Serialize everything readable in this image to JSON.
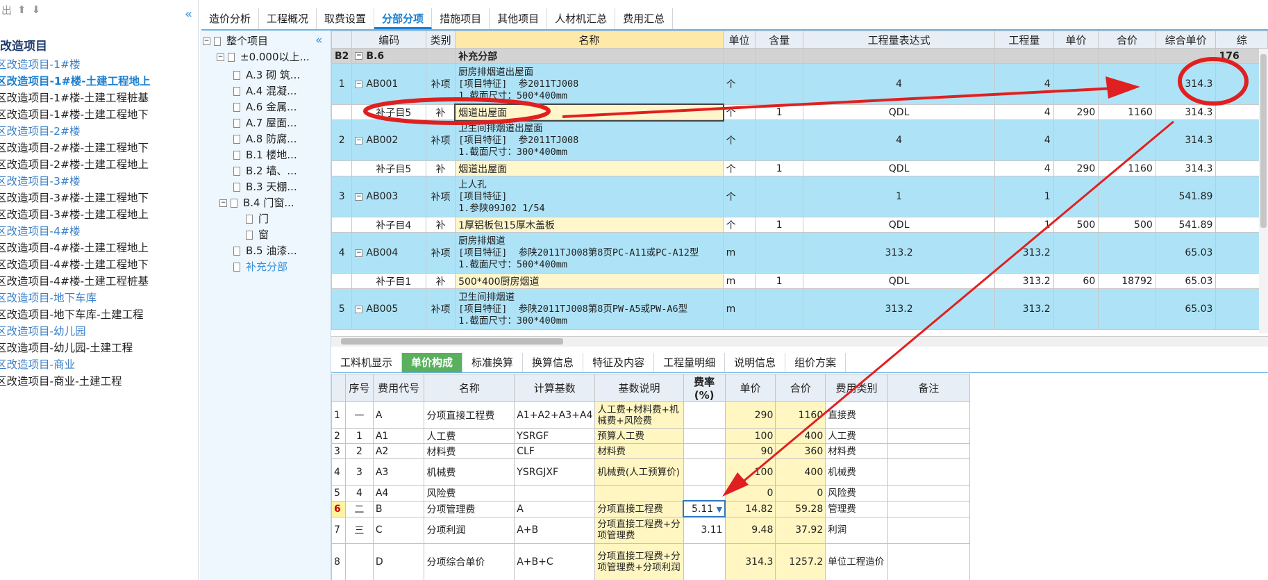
{
  "left_pane": {
    "toolbar_label": "出",
    "title": "改造项目",
    "items": [
      {
        "label": "区改造项目-1#楼",
        "type": "group"
      },
      {
        "label": "区改造项目-1#楼-土建工程地上",
        "type": "active"
      },
      {
        "label": "区改造项目-1#楼-土建工程桩基",
        "type": "item"
      },
      {
        "label": "区改造项目-1#楼-土建工程地下",
        "type": "item"
      },
      {
        "label": "区改造项目-2#楼",
        "type": "group"
      },
      {
        "label": "区改造项目-2#楼-土建工程地下",
        "type": "item"
      },
      {
        "label": "区改造项目-2#楼-土建工程地上",
        "type": "item"
      },
      {
        "label": "区改造项目-3#楼",
        "type": "group"
      },
      {
        "label": "区改造项目-3#楼-土建工程地下",
        "type": "item"
      },
      {
        "label": "区改造项目-3#楼-土建工程地上",
        "type": "item"
      },
      {
        "label": "区改造项目-4#楼",
        "type": "group"
      },
      {
        "label": "区改造项目-4#楼-土建工程地上",
        "type": "item"
      },
      {
        "label": "区改造项目-4#楼-土建工程地下",
        "type": "item"
      },
      {
        "label": "区改造项目-4#楼-土建工程桩基",
        "type": "item"
      },
      {
        "label": "区改造项目-地下车库",
        "type": "group"
      },
      {
        "label": "区改造项目-地下车库-土建工程",
        "type": "item"
      },
      {
        "label": "区改造项目-幼儿园",
        "type": "group"
      },
      {
        "label": "区改造项目-幼儿园-土建工程",
        "type": "item"
      },
      {
        "label": "区改造项目-商业",
        "type": "group"
      },
      {
        "label": "区改造项目-商业-土建工程",
        "type": "item"
      }
    ]
  },
  "top_tabs": [
    "造价分析",
    "工程概况",
    "取费设置",
    "分部分项",
    "措施项目",
    "其他项目",
    "人材机汇总",
    "费用汇总"
  ],
  "active_top_tab": "分部分项",
  "tree": {
    "root": "整个项目",
    "level1": "±0.000以上...",
    "nodes": [
      "A.3 砌 筑...",
      "A.4 混凝...",
      "A.6 金属...",
      "A.7 屋面...",
      "A.8 防腐...",
      "B.1 楼地...",
      "B.2 墙、...",
      "B.3 天棚...",
      "B.4 门窗...",
      "门",
      "窗",
      "B.5 油漆...",
      "补充分部"
    ]
  },
  "grid": {
    "headers": [
      "编码",
      "类别",
      "名称",
      "单位",
      "含量",
      "工程量表达式",
      "工程量",
      "单价",
      "合价",
      "综合单价",
      "综"
    ],
    "part_row": {
      "idx": "B2",
      "code": "B.6",
      "name": "补充分部",
      "extra": "176"
    },
    "rows": [
      {
        "kind": "item",
        "idx": "1",
        "code": "AB001",
        "type": "补项",
        "name": "厨房排烟道出屋面\n[项目特征]  参2011TJ008\n1.截面尺寸：500*400mm",
        "unit": "个",
        "content": "",
        "expr": "4",
        "qty": "4",
        "price": "",
        "total": "",
        "unit_price": "314.3"
      },
      {
        "kind": "sub",
        "idx": "",
        "code": "补子目5",
        "type": "补",
        "name": "烟道出屋面",
        "unit": "个",
        "content": "1",
        "expr": "QDL",
        "qty": "4",
        "price": "290",
        "total": "1160",
        "unit_price": "314.3"
      },
      {
        "kind": "item",
        "idx": "2",
        "code": "AB002",
        "type": "补项",
        "name": "卫生间排烟道出屋面\n[项目特征]  参2011TJ008\n1.截面尺寸：300*400mm",
        "unit": "个",
        "content": "",
        "expr": "4",
        "qty": "4",
        "price": "",
        "total": "",
        "unit_price": "314.3"
      },
      {
        "kind": "sub",
        "idx": "",
        "code": "补子目5",
        "type": "补",
        "name": "烟道出屋面",
        "unit": "个",
        "content": "1",
        "expr": "QDL",
        "qty": "4",
        "price": "290",
        "total": "1160",
        "unit_price": "314.3"
      },
      {
        "kind": "item",
        "idx": "3",
        "code": "AB003",
        "type": "补项",
        "name": "上人孔\n[项目特征]\n1.参陕09J02 1/54",
        "unit": "个",
        "content": "",
        "expr": "1",
        "qty": "1",
        "price": "",
        "total": "",
        "unit_price": "541.89"
      },
      {
        "kind": "sub",
        "idx": "",
        "code": "补子目4",
        "type": "补",
        "name": "1厚铝板包15厚木盖板",
        "unit": "个",
        "content": "1",
        "expr": "QDL",
        "qty": "1",
        "price": "500",
        "total": "500",
        "unit_price": "541.89"
      },
      {
        "kind": "item",
        "idx": "4",
        "code": "AB004",
        "type": "补项",
        "name": "厨房排烟道\n[项目特征]  参陕2011TJ008第8页PC-A11或PC-A12型\n1.截面尺寸：500*400mm",
        "unit": "m",
        "content": "",
        "expr": "313.2",
        "qty": "313.2",
        "price": "",
        "total": "",
        "unit_price": "65.03"
      },
      {
        "kind": "sub",
        "idx": "",
        "code": "补子目1",
        "type": "补",
        "name": "500*400厨房烟道",
        "unit": "m",
        "content": "1",
        "expr": "QDL",
        "qty": "313.2",
        "price": "60",
        "total": "18792",
        "unit_price": "65.03"
      },
      {
        "kind": "item",
        "idx": "5",
        "code": "AB005",
        "type": "补项",
        "name": "卫生间排烟道\n[项目特征]  参陕2011TJ008第8页PW-A5或PW-A6型\n1.截面尺寸：300*400mm",
        "unit": "m",
        "content": "",
        "expr": "313.2",
        "qty": "313.2",
        "price": "",
        "total": "",
        "unit_price": "65.03"
      }
    ]
  },
  "bottom_tabs": [
    "工料机显示",
    "单价构成",
    "标准换算",
    "换算信息",
    "特征及内容",
    "工程量明细",
    "说明信息",
    "组价方案"
  ],
  "active_bottom_tab": "单价构成",
  "bottom_grid": {
    "headers": [
      "序号",
      "费用代号",
      "名称",
      "计算基数",
      "基数说明",
      "费率(%)",
      "单价",
      "合价",
      "费用类别",
      "备注"
    ],
    "rows": [
      {
        "row": "1",
        "seq": "一",
        "code": "A",
        "name": "分项直接工程费",
        "base": "A1+A2+A3+A4",
        "desc": "人工费+材料费+机械费+风险费",
        "rate": "",
        "price": "290",
        "total": "1160",
        "cat": "直接费",
        "note": ""
      },
      {
        "row": "2",
        "seq": "1",
        "code": "A1",
        "name": "人工费",
        "base": "YSRGF",
        "desc": "预算人工费",
        "rate": "",
        "price": "100",
        "total": "400",
        "cat": "人工费",
        "note": ""
      },
      {
        "row": "3",
        "seq": "2",
        "code": "A2",
        "name": "材料费",
        "base": "CLF",
        "desc": "材料费",
        "rate": "",
        "price": "90",
        "total": "360",
        "cat": "材料费",
        "note": ""
      },
      {
        "row": "4",
        "seq": "3",
        "code": "A3",
        "name": "机械费",
        "base": "YSRGJXF",
        "desc": "机械费(人工预算价)",
        "rate": "",
        "price": "100",
        "total": "400",
        "cat": "机械费",
        "note": ""
      },
      {
        "row": "5",
        "seq": "4",
        "code": "A4",
        "name": "风险费",
        "base": "",
        "desc": "",
        "rate": "",
        "price": "0",
        "total": "0",
        "cat": "风险费",
        "note": ""
      },
      {
        "row": "6",
        "seq": "二",
        "code": "B",
        "name": "分项管理费",
        "base": "A",
        "desc": "分项直接工程费",
        "rate": "5.11",
        "price": "14.82",
        "total": "59.28",
        "cat": "管理费",
        "note": ""
      },
      {
        "row": "7",
        "seq": "三",
        "code": "C",
        "name": "分项利润",
        "base": "A+B",
        "desc": "分项直接工程费+分项管理费",
        "rate": "3.11",
        "price": "9.48",
        "total": "37.92",
        "cat": "利润",
        "note": ""
      },
      {
        "row": "8",
        "seq": "",
        "code": "D",
        "name": "分项综合单价",
        "base": "A+B+C",
        "desc": "分项直接工程费+分项管理费+分项利润",
        "rate": "",
        "price": "314.3",
        "total": "1257.2",
        "cat": "单位工程造价",
        "note": ""
      }
    ]
  }
}
